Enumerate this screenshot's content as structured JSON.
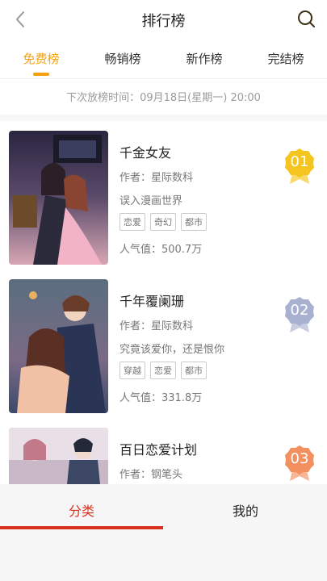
{
  "header": {
    "title": "排行榜",
    "back_icon": "back-chevron-icon",
    "search_icon": "search-icon"
  },
  "tabs": [
    {
      "label": "免费榜"
    },
    {
      "label": "畅销榜"
    },
    {
      "label": "新作榜"
    },
    {
      "label": "完结榜"
    }
  ],
  "notice": "下次放榜时间：09月18日(星期一) 20:00",
  "items": [
    {
      "rank": "01",
      "name": "千金女友",
      "author": "作者：星际数科",
      "desc": "误入漫画世界",
      "tags": [
        "恋爱",
        "奇幻",
        "都市"
      ],
      "popularity": "人气值：500.7万",
      "badge_color": "#f5c51f"
    },
    {
      "rank": "02",
      "name": "千年覆阑珊",
      "author": "作者：星际数科",
      "desc": "究竟该爱你，还是恨你",
      "tags": [
        "穿越",
        "恋爱",
        "都市"
      ],
      "popularity": "人气值：331.8万",
      "badge_color": "#a9b1d1"
    },
    {
      "rank": "03",
      "name": "百日恋爱计划",
      "author": "作者：钢笔头",
      "desc": "",
      "tags": [],
      "popularity": "",
      "badge_color": "#f3905f"
    }
  ],
  "bottom_nav": [
    {
      "label": "分类"
    },
    {
      "label": "我的"
    }
  ]
}
